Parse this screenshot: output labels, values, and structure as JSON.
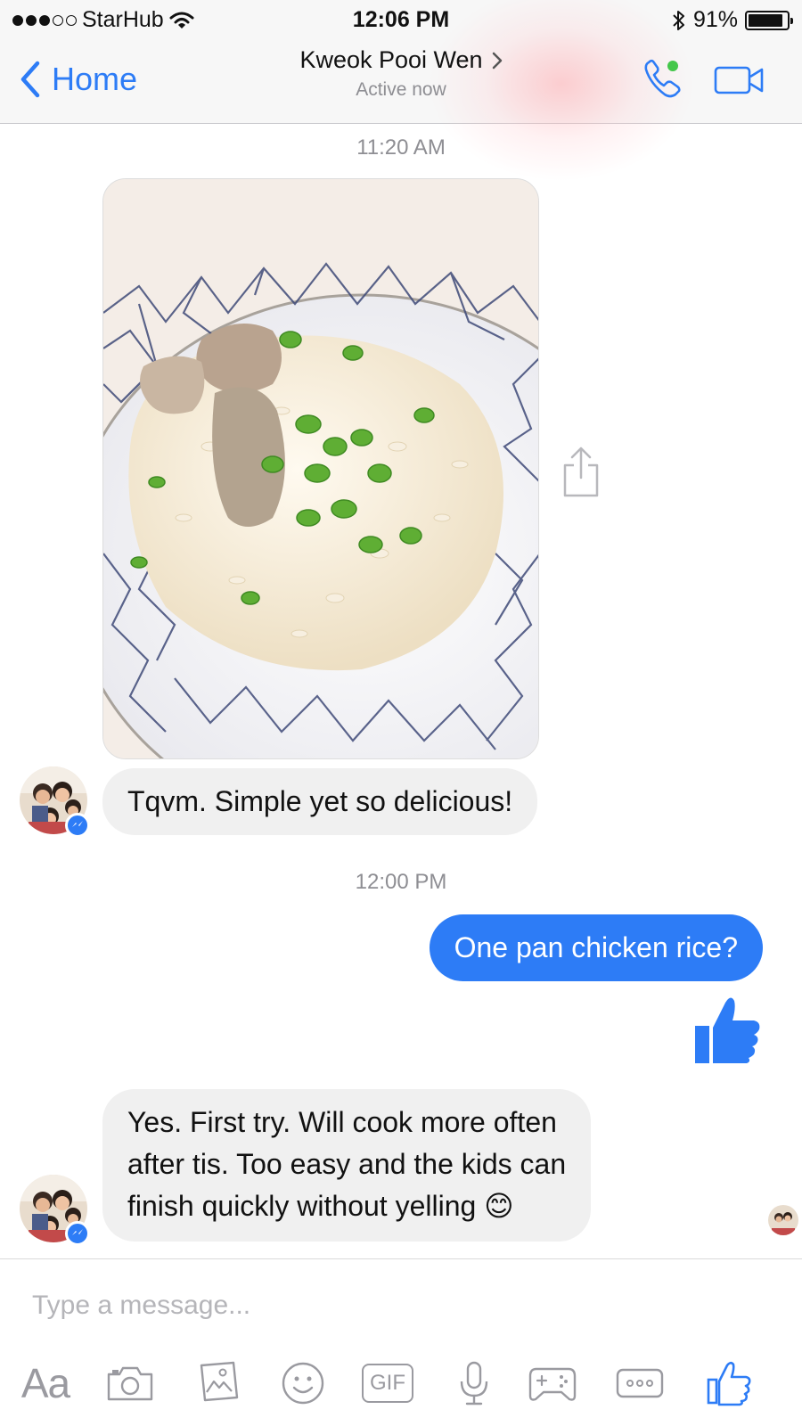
{
  "status_bar": {
    "carrier": "StarHub",
    "time": "12:06 PM",
    "battery": "91%",
    "battery_level": 0.91,
    "signal_bars": 3,
    "signal_max": 5
  },
  "nav": {
    "back_label": "Home",
    "contact_name": "Kweok Pooi Wen",
    "status": "Active now",
    "accent_color": "#2d7cf6",
    "online_dot_color": "#44c74a"
  },
  "chat": {
    "timestamp_1": "11:20 AM",
    "photo_icon": "chicken-rice-photo",
    "incoming_1": "Tqvm. Simple yet so delicious!",
    "timestamp_2": "12:00 PM",
    "outgoing_1": "One pan chicken rice?",
    "outgoing_like_icon": "thumbs-up-icon",
    "incoming_2_lines": [
      "Yes. First try. Will cook more often",
      "after tis. Too easy and the kids can",
      "finish quickly without yelling"
    ],
    "incoming_2_emoji": "😊",
    "bubble_incoming_color": "#f0f0f0",
    "bubble_outgoing_color": "#2d7cf6"
  },
  "composer": {
    "placeholder": "Type a message...",
    "tools": [
      "text-format-icon",
      "camera-icon",
      "gallery-icon",
      "emoji-icon",
      "gif-icon",
      "microphone-icon",
      "game-controller-icon",
      "more-icon",
      "thumbs-up-icon"
    ],
    "aa_label": "Aa",
    "gif_label": "GIF"
  }
}
